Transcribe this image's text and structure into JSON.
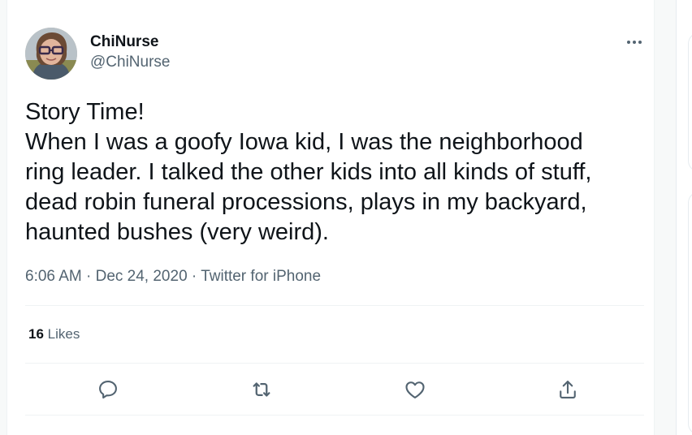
{
  "tweet": {
    "author": {
      "display_name": "ChiNurse",
      "handle": "@ChiNurse",
      "avatar_icon": "profile-photo"
    },
    "more_icon": "more-options-icon",
    "text_lines": [
      "Story Time!",
      "When I was a goofy Iowa kid, I was the neighborhood",
      "ring leader. I talked the other kids into all kinds of stuff,",
      "dead robin funeral processions, plays in my backyard,",
      "haunted bushes (very weird)."
    ],
    "meta": {
      "time": "6:06 AM",
      "separator": "·",
      "date": "Dec 24, 2020",
      "source": "Twitter for iPhone"
    },
    "stats": {
      "likes_count": "16",
      "likes_label": "Likes"
    },
    "actions": [
      {
        "name": "reply",
        "icon": "reply-icon"
      },
      {
        "name": "retweet",
        "icon": "retweet-icon"
      },
      {
        "name": "like",
        "icon": "heart-icon"
      },
      {
        "name": "share",
        "icon": "share-icon"
      }
    ]
  },
  "colors": {
    "text_primary": "#0f1419",
    "text_secondary": "#536471",
    "divider": "#eff3f4",
    "icon": "#536471"
  }
}
